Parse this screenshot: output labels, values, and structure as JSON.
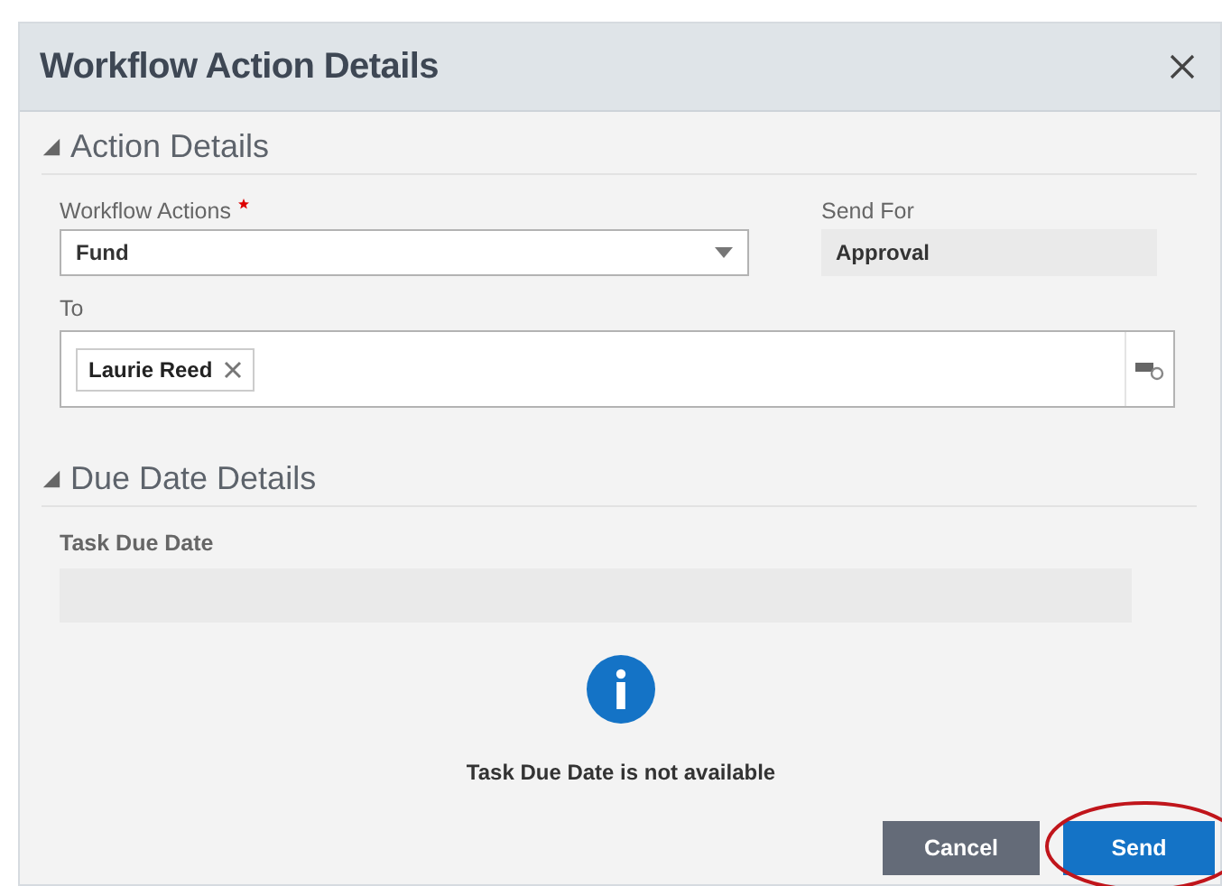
{
  "window": {
    "title": "Workflow Action Details"
  },
  "sections": [
    {
      "title": "Action Details",
      "expanded": true,
      "kind": "action"
    },
    {
      "title": "Due Date Details",
      "expanded": true,
      "kind": "due"
    }
  ],
  "workflow_actions": {
    "label": "Workflow Actions",
    "required": true,
    "value": "Fund"
  },
  "send_for": {
    "label": "Send For",
    "value": "Approval"
  },
  "to": {
    "label": "To",
    "tokens": [
      {
        "name": "Laurie Reed"
      }
    ]
  },
  "task_due_date": {
    "label": "Task Due Date",
    "message": "Task Due Date is not available"
  },
  "buttons": [
    {
      "label": "Cancel",
      "kind": "secondary",
      "highlighted": false
    },
    {
      "label": "Send",
      "kind": "primary",
      "highlighted": true
    }
  ]
}
